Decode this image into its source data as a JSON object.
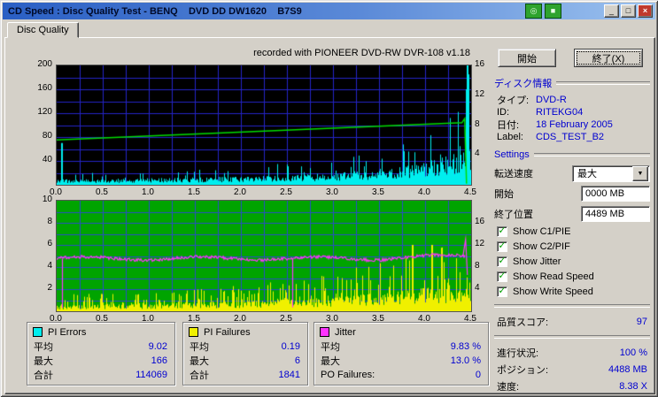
{
  "window": {
    "title": "CD Speed : Disc Quality Test - BENQ    DVD DD DW1620    B7S9",
    "titlebar_icons": [
      {
        "name": "disc-icon",
        "glyph": "◎"
      },
      {
        "name": "chart-icon",
        "glyph": "■"
      }
    ],
    "buttons": {
      "minimize": "_",
      "maximize": "□",
      "close": "×"
    }
  },
  "tabs": {
    "disc_quality": "Disc Quality"
  },
  "chart": {
    "recorded_with": "recorded with PIONEER DVD-RW  DVR-108  v1.18"
  },
  "chart_data": [
    {
      "type": "area",
      "name": "PI Errors with Write Speed",
      "x_min": 0,
      "x_max": 4.5,
      "x_unit": "GB",
      "x_ticks": [
        "0.0",
        "0.5",
        "1.0",
        "1.5",
        "2.0",
        "2.5",
        "3.0",
        "3.5",
        "4.0",
        "4.5"
      ],
      "y_left": {
        "max": 200,
        "ticks": [
          200,
          160,
          120,
          80,
          40
        ]
      },
      "y_right": {
        "max": 16,
        "ticks": [
          16,
          12,
          8,
          4
        ]
      },
      "bg": "#000000",
      "grid_color": "#2424c8",
      "grid": {
        "v_step": 0.25,
        "h_step": 20
      },
      "series": [
        {
          "name": "PI Errors",
          "style": "spikes",
          "color": "#00eeee",
          "avg": 9.02,
          "max": 166,
          "total": 114069,
          "band": [
            0.16,
            0.5
          ],
          "p": 0.09,
          "spike": [
            0.5,
            1.1
          ],
          "envelope": [
            [
              0,
              18
            ],
            [
              0.5,
              20
            ],
            [
              1,
              22
            ],
            [
              1.5,
              25
            ],
            [
              2,
              28
            ],
            [
              2.5,
              33
            ],
            [
              3,
              40
            ],
            [
              3.3,
              48
            ],
            [
              3.6,
              58
            ],
            [
              3.9,
              72
            ],
            [
              4.1,
              85
            ],
            [
              4.3,
              105
            ],
            [
              4.4,
              140
            ],
            [
              4.45,
              200
            ],
            [
              4.5,
              120
            ]
          ],
          "spikes": [
            [
              0.05,
              70
            ],
            [
              4.44,
              160
            ],
            [
              4.45,
              200
            ],
            [
              4.46,
              185
            ]
          ]
        },
        {
          "name": "Write Speed",
          "style": "line",
          "color": "#00dd00",
          "points": [
            [
              0,
              75
            ],
            [
              4.4,
              104
            ],
            [
              4.43,
              111
            ],
            [
              4.45,
              2
            ]
          ]
        }
      ]
    },
    {
      "type": "area",
      "name": "PI Failures with Jitter",
      "x_min": 0,
      "x_max": 4.5,
      "x_unit": "GB",
      "x_ticks": [
        "0.0",
        "0.5",
        "1.0",
        "1.5",
        "2.0",
        "2.5",
        "3.0",
        "3.5",
        "4.0",
        "4.5"
      ],
      "y_left": {
        "max": 10,
        "ticks": [
          10,
          8,
          6,
          4,
          2
        ]
      },
      "y_right": {
        "max": 20,
        "ticks": [
          16,
          12,
          8,
          4
        ]
      },
      "bg": "#00a400",
      "grid_color": "#2a4cc8",
      "grid": {
        "v_step": 0.25,
        "h_step": 1
      },
      "series": [
        {
          "name": "PI Failures",
          "style": "spikes",
          "color": "#f0f000",
          "avg": 0.19,
          "max": 6,
          "total": 1841,
          "band": [
            0.12,
            0.38
          ],
          "p": 0.26,
          "spike": [
            0.35,
            1.05
          ],
          "clamp": 6.2,
          "envelope": [
            [
              0,
              1.4
            ],
            [
              0.5,
              1.6
            ],
            [
              1,
              1.7
            ],
            [
              1.5,
              2.0
            ],
            [
              2,
              2.4
            ],
            [
              2.5,
              2.8
            ],
            [
              3,
              3.3
            ],
            [
              3.4,
              4.2
            ],
            [
              3.8,
              5.3
            ],
            [
              4.1,
              5.8
            ],
            [
              4.3,
              5.2
            ],
            [
              4.45,
              4.5
            ],
            [
              4.5,
              2.5
            ]
          ],
          "spikes": [
            [
              3.86,
              6
            ],
            [
              4.07,
              6
            ]
          ]
        },
        {
          "name": "Jitter",
          "style": "jitterline",
          "color": "#ff33ff",
          "avg": 9.83,
          "max": 13.0,
          "base": 9.55,
          "end_spike": [
            4.44,
            13.0
          ],
          "down_spikes": [
            [
              0.06,
              0.6
            ],
            [
              2.56,
              0.7
            ]
          ]
        }
      ]
    }
  ],
  "legend": {
    "pi_errors": {
      "title": "PI Errors",
      "color": "#00eeee",
      "avg_label": "平均",
      "avg": "9.02",
      "max_label": "最大",
      "max": "166",
      "total_label": "合計",
      "total": "114069"
    },
    "pi_failures": {
      "title": "PI Failures",
      "color": "#f0f000",
      "avg_label": "平均",
      "avg": "0.19",
      "max_label": "最大",
      "max": "6",
      "total_label": "合計",
      "total": "1841"
    },
    "jitter": {
      "title": "Jitter",
      "color": "#ff33ff",
      "avg_label": "平均",
      "avg": "9.83 %",
      "max_label": "最大",
      "max": "13.0 %",
      "po_label": "PO Failures:",
      "po": "0"
    }
  },
  "side": {
    "start_button": "開始",
    "exit_button": "終了(X)",
    "disc_info": {
      "header": "ディスク情報",
      "rows": [
        {
          "label": "タイプ:",
          "value": "DVD-R"
        },
        {
          "label": "ID:",
          "value": "RITEKG04"
        },
        {
          "label": "日付:",
          "value": "18 February 2005"
        },
        {
          "label": "Label:",
          "value": "CDS_TEST_B2"
        }
      ]
    },
    "settings": {
      "header": "Settings",
      "speed_label": "転送速度",
      "speed_value": "最大",
      "start_label": "開始",
      "start_value": "0000 MB",
      "end_label": "終了位置",
      "end_value": "4489 MB",
      "checkboxes": [
        "Show C1/PIE",
        "Show C2/PIF",
        "Show Jitter",
        "Show Read Speed",
        "Show Write Speed"
      ]
    },
    "score_label": "品質スコア:",
    "score_value": "97",
    "progress_label": "進行状況:",
    "progress_value": "100 %",
    "position_label": "ポジション:",
    "position_value": "4488 MB",
    "speed_label": "速度:",
    "speed_value": "8.38 X"
  },
  "ui": {
    "combo_arrow": "▼",
    "check_glyph": "✓"
  }
}
